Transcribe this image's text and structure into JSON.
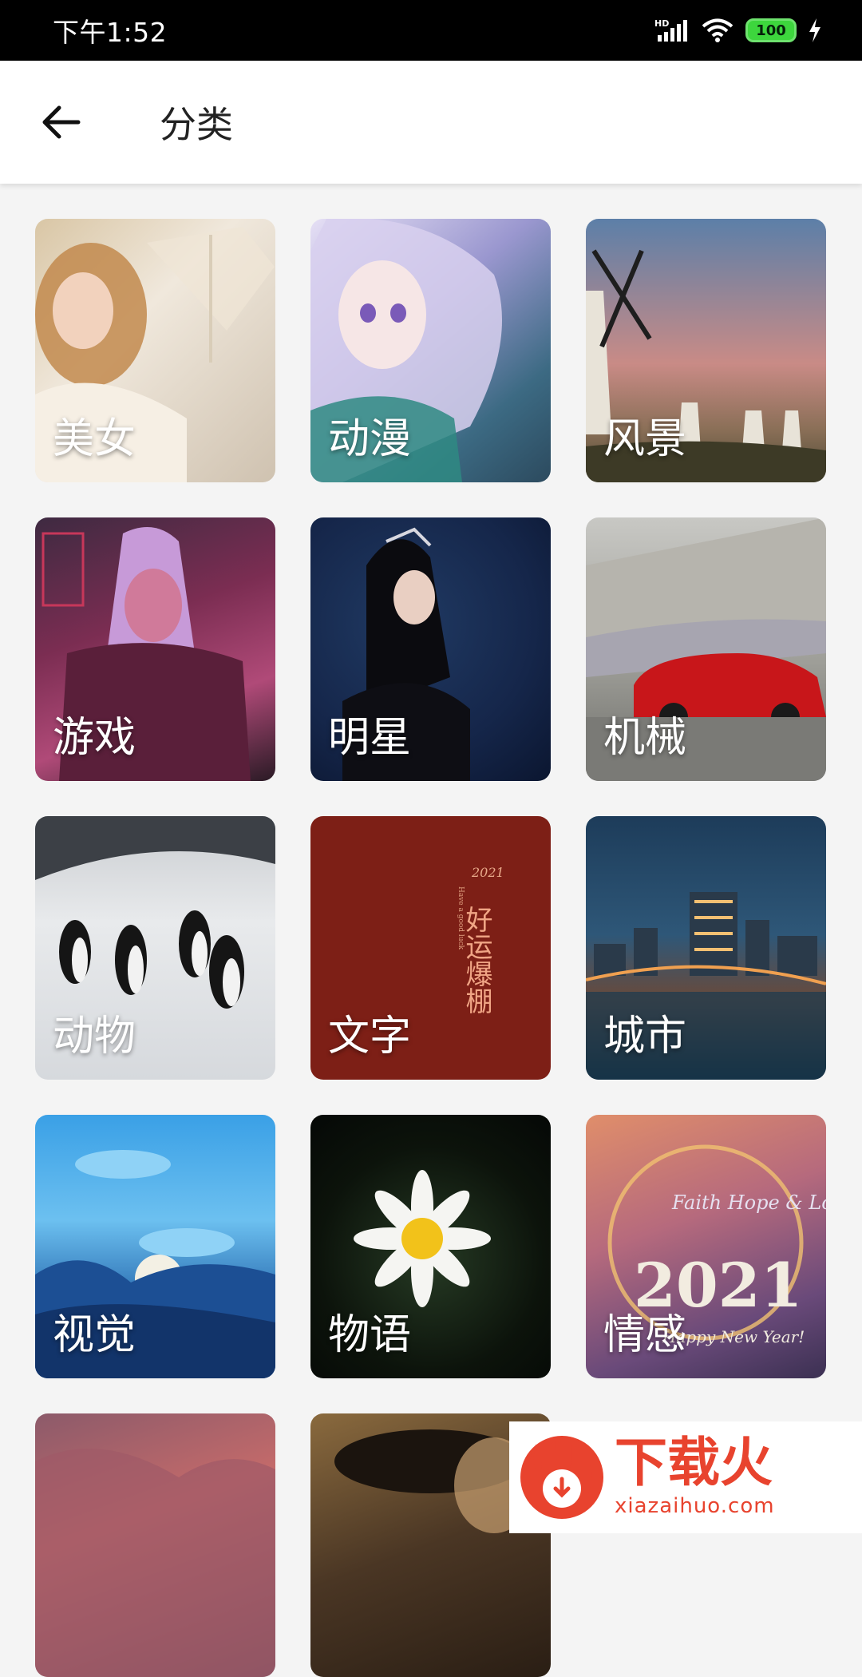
{
  "status_bar": {
    "time": "下午1:52",
    "battery": "100"
  },
  "app_bar": {
    "title": "分类"
  },
  "categories": [
    {
      "label": "美女"
    },
    {
      "label": "动漫"
    },
    {
      "label": "风景"
    },
    {
      "label": "游戏"
    },
    {
      "label": "明星"
    },
    {
      "label": "机械"
    },
    {
      "label": "动物"
    },
    {
      "label": "文字"
    },
    {
      "label": "城市"
    },
    {
      "label": "视觉"
    },
    {
      "label": "物语"
    },
    {
      "label": "情感"
    },
    {
      "label": ""
    },
    {
      "label": ""
    }
  ],
  "card_text": {
    "wenzi_year": "2021",
    "wenzi_phrase": "好运爆棚",
    "wenzi_small": "Have a good luck",
    "qinggan_text": "Faith Hope & Love",
    "qinggan_year": "2021",
    "qinggan_greeting": "Happy New Year!"
  },
  "watermark": {
    "brand": "下载火",
    "url": "xiazaihuo.com"
  }
}
